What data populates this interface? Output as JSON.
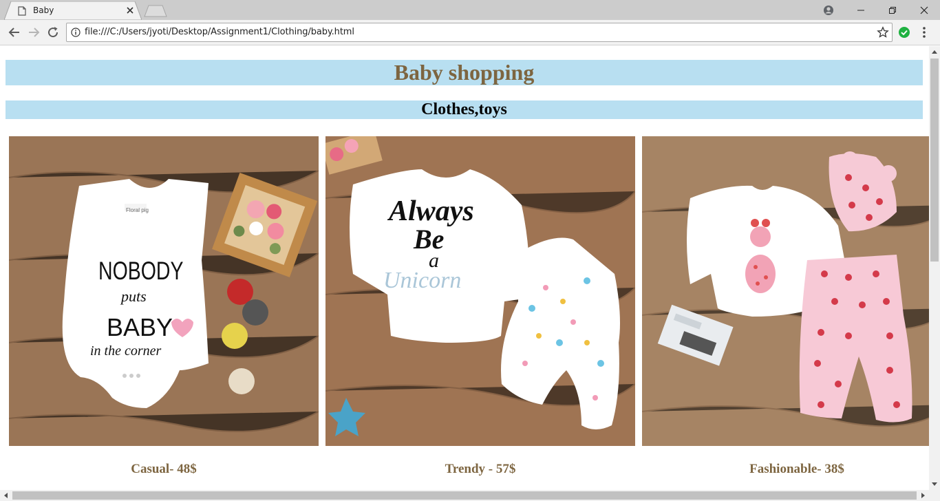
{
  "browser": {
    "tab_title": "Baby",
    "url": "file:///C:/Users/jyoti/Desktop/Assignment1/Clothing/baby.html"
  },
  "page": {
    "heading": "Baby shopping",
    "subheading": "Clothes,toys",
    "products": [
      {
        "caption": "Casual- 48$",
        "image": "white sleeveless onesie 'NOBODY puts BABY in the corner' on wooden floor"
      },
      {
        "caption": "Trendy - 57$",
        "image": "'Always Be a Unicorn' onesie with unicorn print pants"
      },
      {
        "caption": "Fashionable- 38$",
        "image": "giraffe onesie with pink polka-dot pants and hat"
      }
    ]
  },
  "colors": {
    "banner_bg": "#b8dff1",
    "heading_text": "#7d6540",
    "wood": "#9a7556"
  },
  "icons": [
    "page-icon",
    "close-icon",
    "profile-icon",
    "minimize-icon",
    "restore-icon",
    "close-window-icon",
    "back-icon",
    "forward-icon",
    "reload-icon",
    "info-icon",
    "star-icon",
    "check-icon",
    "menu-icon"
  ]
}
